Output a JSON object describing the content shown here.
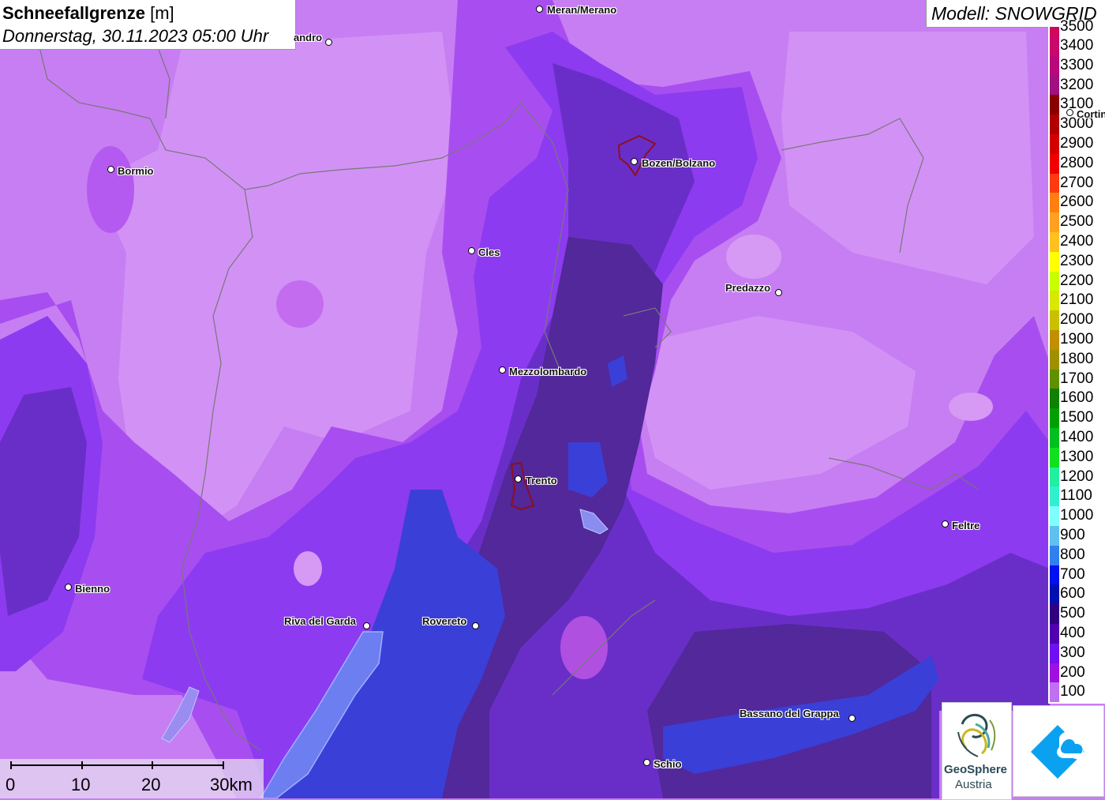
{
  "title": {
    "name": "Schneefallgrenze",
    "unit": "[m]",
    "datetime": "Donnerstag, 30.11.2023 05:00 Uhr"
  },
  "model": "Modell: SNOWGRID",
  "legend": {
    "top_label": "3500",
    "entries": [
      {
        "label": "3400",
        "color": "#c8086a"
      },
      {
        "label": "3300",
        "color": "#b8087a"
      },
      {
        "label": "3200",
        "color": "#a0107e"
      },
      {
        "label": "3100",
        "color": "#8a0000"
      },
      {
        "label": "3000",
        "color": "#b00000"
      },
      {
        "label": "2900",
        "color": "#d40000"
      },
      {
        "label": "2800",
        "color": "#f00000"
      },
      {
        "label": "2700",
        "color": "#ff3a10"
      },
      {
        "label": "2600",
        "color": "#ff8010"
      },
      {
        "label": "2500",
        "color": "#ffa020"
      },
      {
        "label": "2400",
        "color": "#ffc020"
      },
      {
        "label": "2300",
        "color": "#ffff00"
      },
      {
        "label": "2200",
        "color": "#c8ff00"
      },
      {
        "label": "2100",
        "color": "#d8e800"
      },
      {
        "label": "2000",
        "color": "#c8c000"
      },
      {
        "label": "1900",
        "color": "#c09000"
      },
      {
        "label": "1800",
        "color": "#a09000"
      },
      {
        "label": "1700",
        "color": "#609000"
      },
      {
        "label": "1600",
        "color": "#108000"
      },
      {
        "label": "1500",
        "color": "#00a000"
      },
      {
        "label": "1400",
        "color": "#00c020"
      },
      {
        "label": "1300",
        "color": "#10e020"
      },
      {
        "label": "1200",
        "color": "#20f0a0"
      },
      {
        "label": "1100",
        "color": "#30f0d0"
      },
      {
        "label": "1000",
        "color": "#80ffff"
      },
      {
        "label": "900",
        "color": "#60c0f0"
      },
      {
        "label": "800",
        "color": "#3080f0"
      },
      {
        "label": "700",
        "color": "#0010f0"
      },
      {
        "label": "600",
        "color": "#0010b0"
      },
      {
        "label": "500",
        "color": "#300080"
      },
      {
        "label": "400",
        "color": "#5000b0"
      },
      {
        "label": "300",
        "color": "#7010f0"
      },
      {
        "label": "200",
        "color": "#a010e0"
      },
      {
        "label": "100",
        "color": "#c070f0"
      }
    ]
  },
  "cities": [
    {
      "name": "Meran/Merano"
    },
    {
      "name": "andro"
    },
    {
      "name": "Bormio"
    },
    {
      "name": "Bozen/Bolzano"
    },
    {
      "name": "Cles"
    },
    {
      "name": "Predazzo"
    },
    {
      "name": "Cortin"
    },
    {
      "name": "Mezzolombardo"
    },
    {
      "name": "Trento"
    },
    {
      "name": "Feltre"
    },
    {
      "name": "Bienno"
    },
    {
      "name": "Riva del Garda"
    },
    {
      "name": "Rovereto"
    },
    {
      "name": "Bassano del Grappa"
    },
    {
      "name": "Schio"
    }
  ],
  "scalebar": {
    "labels": [
      "0",
      "10",
      "20",
      "30km"
    ]
  },
  "logos": {
    "geosphere_line1": "GeoSphere",
    "geosphere_line2": "Austria"
  }
}
